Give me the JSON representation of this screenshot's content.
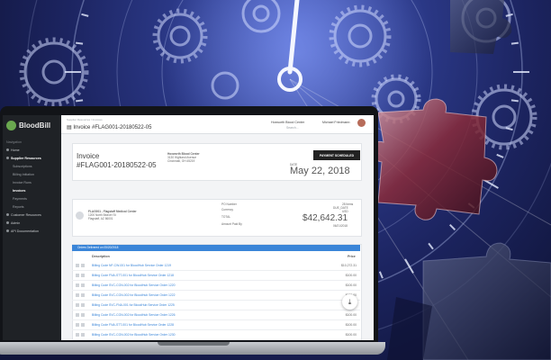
{
  "app": {
    "brand": "BloodBill"
  },
  "sidebar": {
    "heading": "Navigation",
    "items": [
      {
        "label": "Home",
        "level": 0
      },
      {
        "label": "Supplier Resources",
        "level": 0,
        "active": true
      },
      {
        "label": "Subscriptions",
        "level": 1
      },
      {
        "label": "Billing Initiation",
        "level": 1
      },
      {
        "label": "Invoice Runs",
        "level": 1
      },
      {
        "label": "Invoices",
        "level": 1,
        "active": true
      },
      {
        "label": "Payments",
        "level": 1
      },
      {
        "label": "Reports",
        "level": 1
      },
      {
        "label": "Customer Resources",
        "level": 0
      },
      {
        "label": "Admin",
        "level": 0
      },
      {
        "label": "API Documentation",
        "level": 0
      }
    ]
  },
  "topbar": {
    "breadcrumb": "Supplier Resources  /  Invoices",
    "title": "Invoice #FLAG001-20180522-05",
    "org": "Hoxworth Blood Center",
    "user": "Michael Friedmann",
    "search_placeholder": "Search..."
  },
  "invoice": {
    "heading": "Invoice",
    "number": "#FLAG001-20180522-05",
    "from_name": "Hoxworth Blood Center",
    "from_address": [
      "3130 Highland Avenue",
      "Cincinnati, OH 45219"
    ],
    "status": "PAYMENT SCHEDULED",
    "date_label": "DATE",
    "date": "May 22, 2018",
    "to_name": "FLAG001 - Flagstaff Medical Center",
    "to_address": [
      "1200 North Beaver St",
      "Flagstaff, AZ 86001"
    ],
    "labels": [
      "PO Number",
      "Currency",
      "TOTAL",
      "Amount Paid By"
    ],
    "right_labels": [
      "28 Items",
      "DUE_DATE"
    ],
    "currency": "USD",
    "total": "$42,642.31",
    "paid_date": "06/21/2018"
  },
  "table": {
    "group_label": "Orders Delivered on 05/20/2018",
    "col_description": "Description",
    "col_price": "Price",
    "rows": [
      {
        "desc": "Billing Code NF-CW-001 for BloodHub Service Order 1219",
        "price": "$10,272.31"
      },
      {
        "desc": "Billing Code FNA-STT-001 for BloodHub Service Order 1218",
        "price": "$100.00"
      },
      {
        "desc": "Billing Code SVC-CON-002 for BloodHub Service Order 1220",
        "price": "$100.00"
      },
      {
        "desc": "Billing Code SVC-CON-002 for BloodHub Service Order 1222",
        "price": "$100.00"
      },
      {
        "desc": "Billing Code SVC-FNA-001 for BloodHub Service Order 1225",
        "price": "$100.00"
      },
      {
        "desc": "Billing Code SVC-CON-002 for BloodHub Service Order 1226",
        "price": "$100.00"
      },
      {
        "desc": "Billing Code FNA-STT-001 for BloodHub Service Order 1228",
        "price": "$100.00"
      },
      {
        "desc": "Billing Code SVC-CON-002 for BloodHub Service Order 1230",
        "price": "$100.00"
      }
    ]
  },
  "colors": {
    "accent": "#3a85d8",
    "sidebar": "#1f2226",
    "background": "#1c2460"
  },
  "icons": [
    "bloodbill-logo-icon",
    "download-icon",
    "invoice-icon",
    "gear-icon",
    "clock-icon",
    "puzzle-piece-icon"
  ]
}
